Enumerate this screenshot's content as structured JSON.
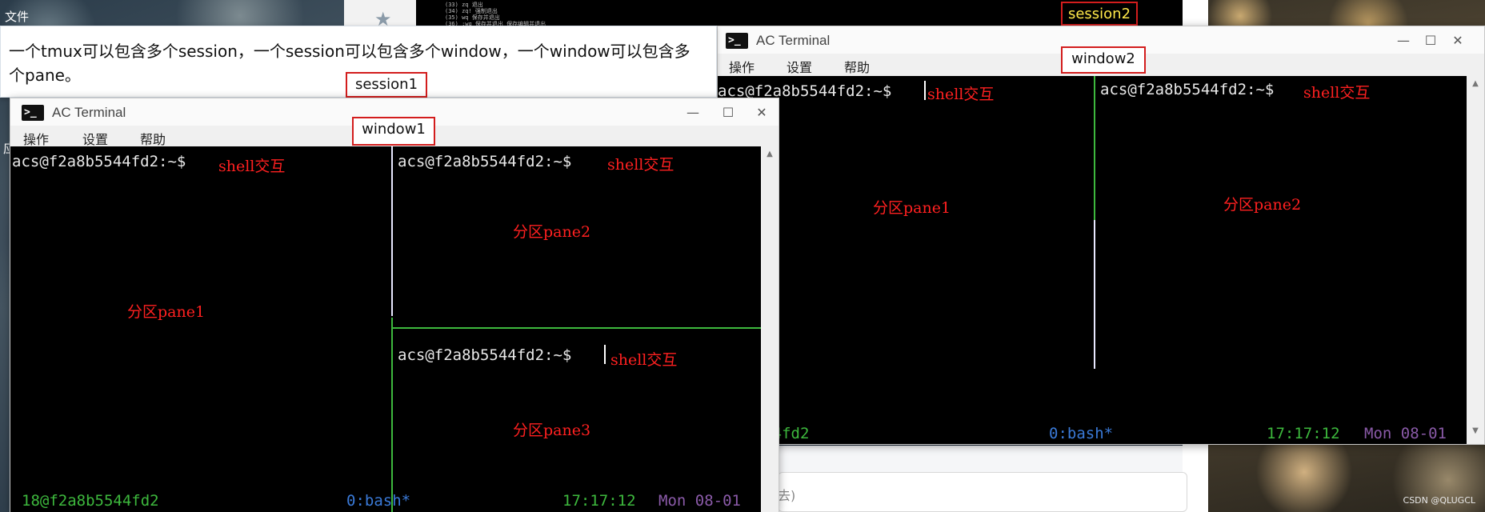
{
  "background": {
    "file_menu": "文件",
    "edge_char": "应",
    "top_terminal_lines": [
      "(33) zq 退出",
      "(34) zq! 强制退出",
      "(35) wq 保存并退出",
      "(36) :wq 保存并退出  保存编辑并退出"
    ],
    "input_hint": "去)",
    "watermark": "CSDN @QLUGCL"
  },
  "note": {
    "text": "一个tmux可以包含多个session，一个session可以包含多个window，一个window可以包含多个pane。"
  },
  "labels": {
    "session1": "session1",
    "session2": "session2",
    "window1": "window1",
    "window2": "window2"
  },
  "window1": {
    "title": "AC Terminal",
    "icon": "terminal-icon",
    "menu": [
      "操作",
      "设置",
      "帮助"
    ],
    "controls": {
      "minimize": "—",
      "maximize": "☐",
      "close": "✕"
    },
    "panes": [
      {
        "prompt": "acs@f2a8b5544fd2:~$",
        "note": "shell交互",
        "label": "分区pane1"
      },
      {
        "prompt": "acs@f2a8b5544fd2:~$",
        "note": "shell交互",
        "label": "分区pane2"
      },
      {
        "prompt": "acs@f2a8b5544fd2:~$",
        "note": "shell交互",
        "label": "分区pane3"
      }
    ],
    "status_bar": {
      "left": "18@f2a8b5544fd2",
      "window": "0:bash*",
      "time": "17:17:12",
      "date": "Mon 08-01"
    }
  },
  "window2": {
    "title": "AC Terminal",
    "icon": "terminal-icon",
    "menu": [
      "操作",
      "设置",
      "帮助"
    ],
    "controls": {
      "minimize": "—",
      "maximize": "☐",
      "close": "✕"
    },
    "panes": [
      {
        "prompt": "acs@f2a8b5544fd2:~$",
        "note": "shell交互",
        "label": "分区pane1"
      },
      {
        "prompt": "acs@f2a8b5544fd2:~$",
        "note": "shell交互",
        "label": "分区pane2"
      }
    ],
    "status_bar": {
      "left": "a8b5544fd2",
      "window": "0:bash*",
      "time": "17:17:12",
      "date": "Mon 08-01"
    }
  },
  "colors": {
    "annotation_red": "#ff2020",
    "label_border": "#d31d1d",
    "tmux_green": "#3db83d",
    "tmux_blue": "#3a7ad8",
    "tmux_purple": "#8a5aa8",
    "session2_text": "#ffe94a"
  }
}
